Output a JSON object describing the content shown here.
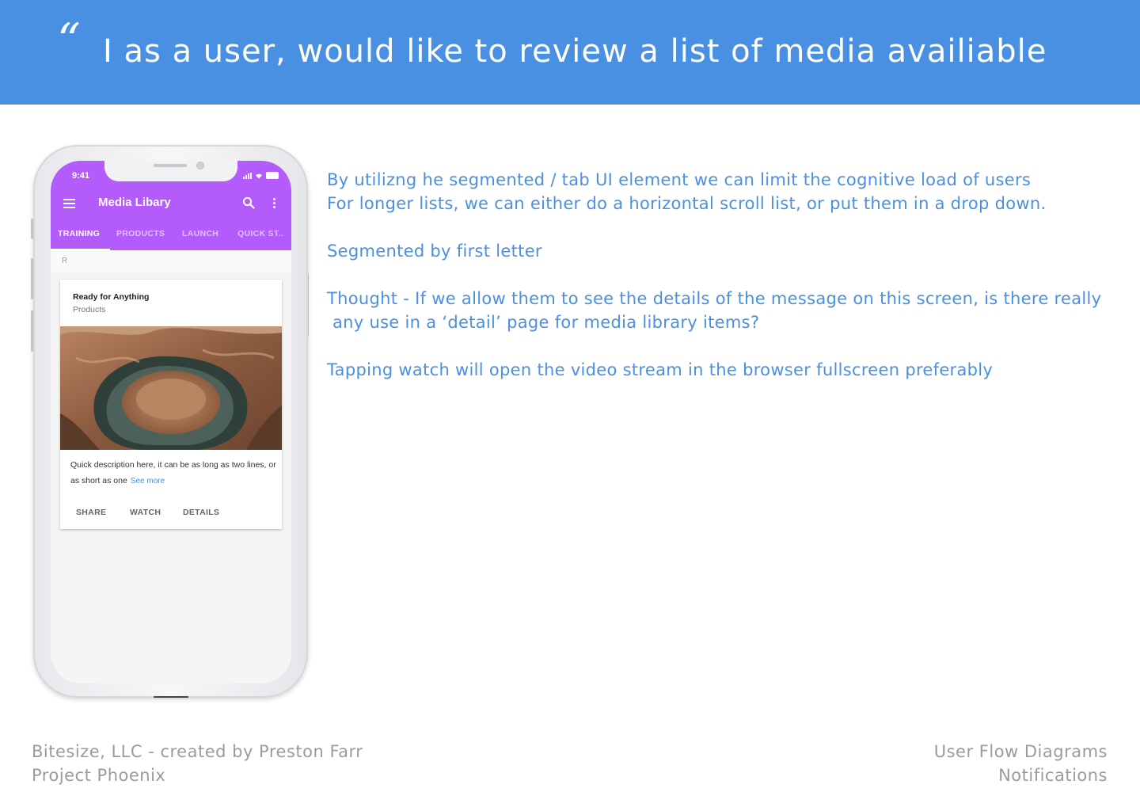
{
  "header": {
    "quote_mark": "“",
    "title": "I as a user, would like to review a list of media availiable"
  },
  "notes": {
    "line1": "By utilizng he segmented / tab UI element we can limit the cognitive load of users",
    "line2": "For longer lists, we can either do a horizontal scroll list, or put them in a drop down.",
    "line3": "Segmented by first letter",
    "line4": "Thought - If we allow them to see the details of the message on this screen, is there really",
    "line5": " any use in a ‘detail’ page for media library items?",
    "line6": "Tapping watch will open the video stream in the browser fullscreen preferably"
  },
  "footer": {
    "left_line1": "Bitesize, LLC - created by Preston Farr",
    "left_line2": "Project Phoenix",
    "right_line1": "User Flow Diagrams",
    "right_line2": "Notifications"
  },
  "phone": {
    "status_time": "9:41",
    "app_title": "Media Libary",
    "accent_color": "#b45cfb",
    "tabs": [
      {
        "label": "TRAINING",
        "active": true
      },
      {
        "label": "PRODUCTS",
        "active": false
      },
      {
        "label": "LAUNCH",
        "active": false
      },
      {
        "label": "QUICK ST..",
        "active": false
      }
    ],
    "section_letter": "R",
    "card": {
      "title": "Ready for Anything",
      "subtitle": "Products",
      "description": "Quick description here, it can be as long as two lines, or as short as one",
      "see_more": "See more",
      "actions": [
        "SHARE",
        "WATCH",
        "DETAILS"
      ]
    }
  },
  "colors": {
    "banner": "#4a90e2",
    "notes_text": "#4a90e2",
    "footer_text": "#9b9b9b"
  }
}
